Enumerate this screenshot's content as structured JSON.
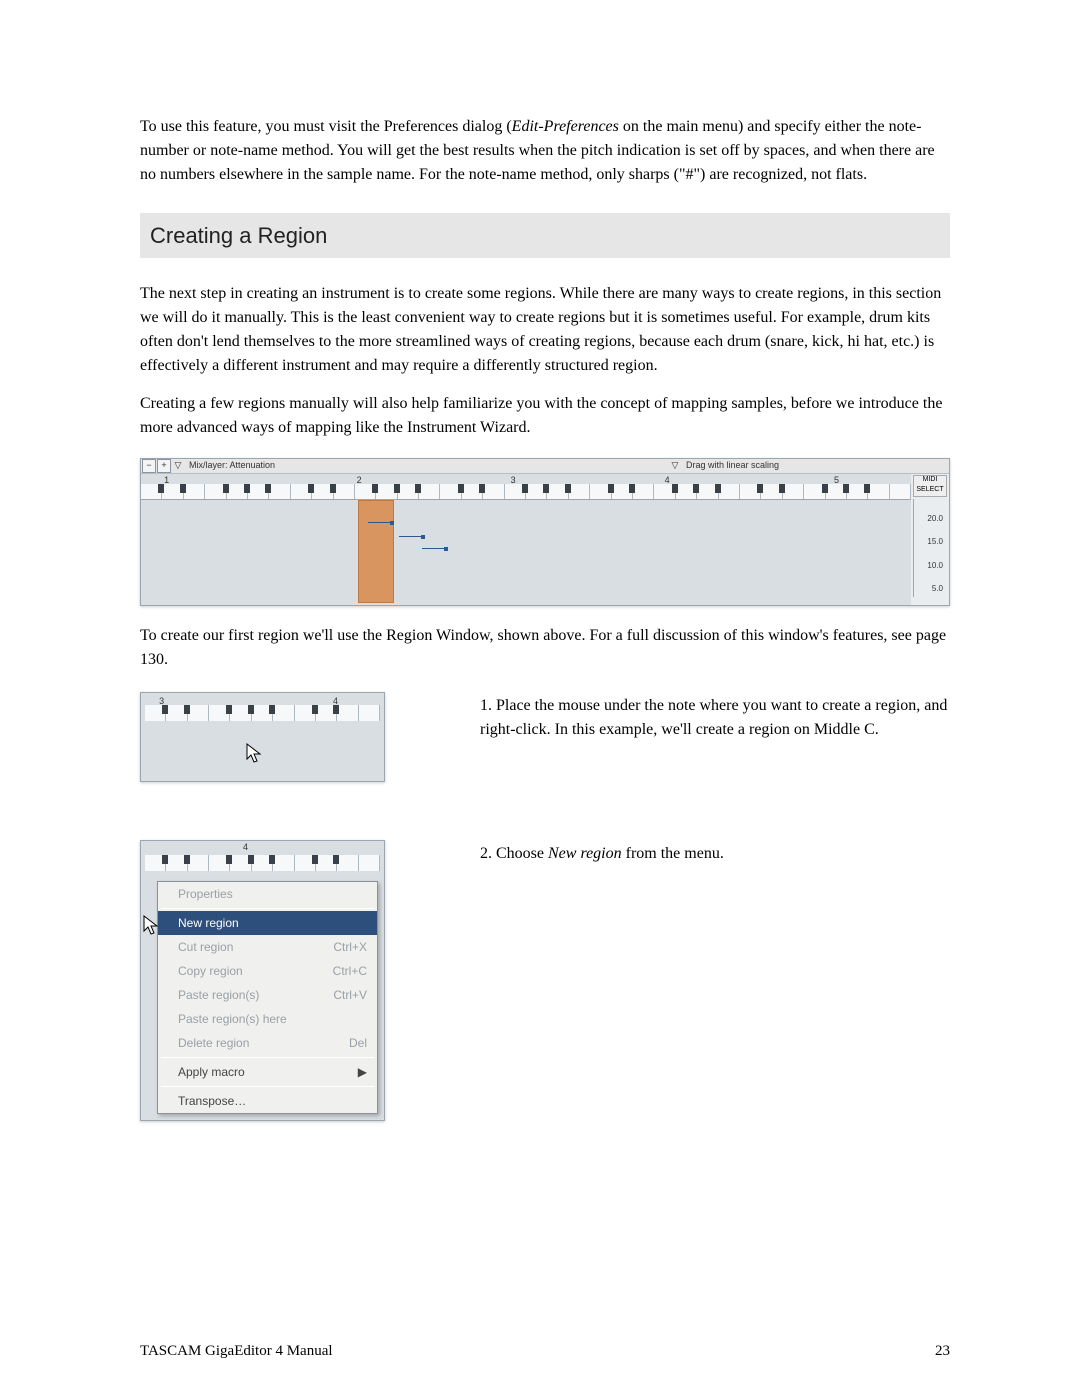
{
  "para1_a": "To use this feature, you must visit the Preferences dialog (",
  "para1_italic": "Edit-Preferences",
  "para1_b": " on the main menu) and specify either the note-number or note-name method.  You will get the best results when the pitch indication is set off by spaces, and when there are no numbers elsewhere in the sample name.  For the note-name method, only sharps (\"#\") are recognized, not flats.",
  "heading": "Creating a Region",
  "para2": "The next step in creating an instrument is to create some regions.  While there are many ways to create regions, in this section we will do it manually.  This is the least convenient way to create regions but it is sometimes useful.  For example, drum kits often don't lend themselves to the more streamlined ways of creating regions, because each drum (snare, kick, hi hat, etc.) is effectively a different instrument and may require a differently structured region.",
  "para3": "Creating a few regions manually will also help familiarize you with the concept of mapping samples, before we introduce the more advanced ways of mapping like the Instrument Wizard.",
  "figMain": {
    "toolbar": {
      "minus": "−",
      "plus": "+",
      "dd": "▽",
      "mixlayer": "Mix/layer: Attenuation",
      "drag": "Drag with linear scaling"
    },
    "midi1": "MIDI",
    "midi2": "SELECT",
    "scale": {
      "v1": "20.0",
      "v2": "15.0",
      "v3": "10.0",
      "v4": "5.0"
    },
    "octaves": [
      "1",
      "2",
      "3",
      "4",
      "5"
    ]
  },
  "para4": "To create our first region we'll use the Region Window, shown above.  For a full discussion of this window's features, see page 130.",
  "figSmall": {
    "oct3": "3",
    "oct4": "4"
  },
  "step1": "1. Place the mouse under the note where you want to create a region, and right-click.  In this example, we'll create a region on Middle C.",
  "step2_a": "2. Choose ",
  "step2_italic": "New region",
  "step2_b": " from the menu.",
  "figMenu": {
    "oct4": "4"
  },
  "menu": {
    "properties": "Properties",
    "newregion": "New region",
    "cut": "Cut region",
    "cut_sc": "Ctrl+X",
    "copy": "Copy region",
    "copy_sc": "Ctrl+C",
    "paste": "Paste region(s)",
    "paste_sc": "Ctrl+V",
    "pastehere": "Paste region(s) here",
    "delete": "Delete region",
    "delete_sc": "Del",
    "applymacro": "Apply macro",
    "transpose": "Transpose…"
  },
  "footer": {
    "title": "TASCAM GigaEditor 4 Manual",
    "page": "23"
  }
}
